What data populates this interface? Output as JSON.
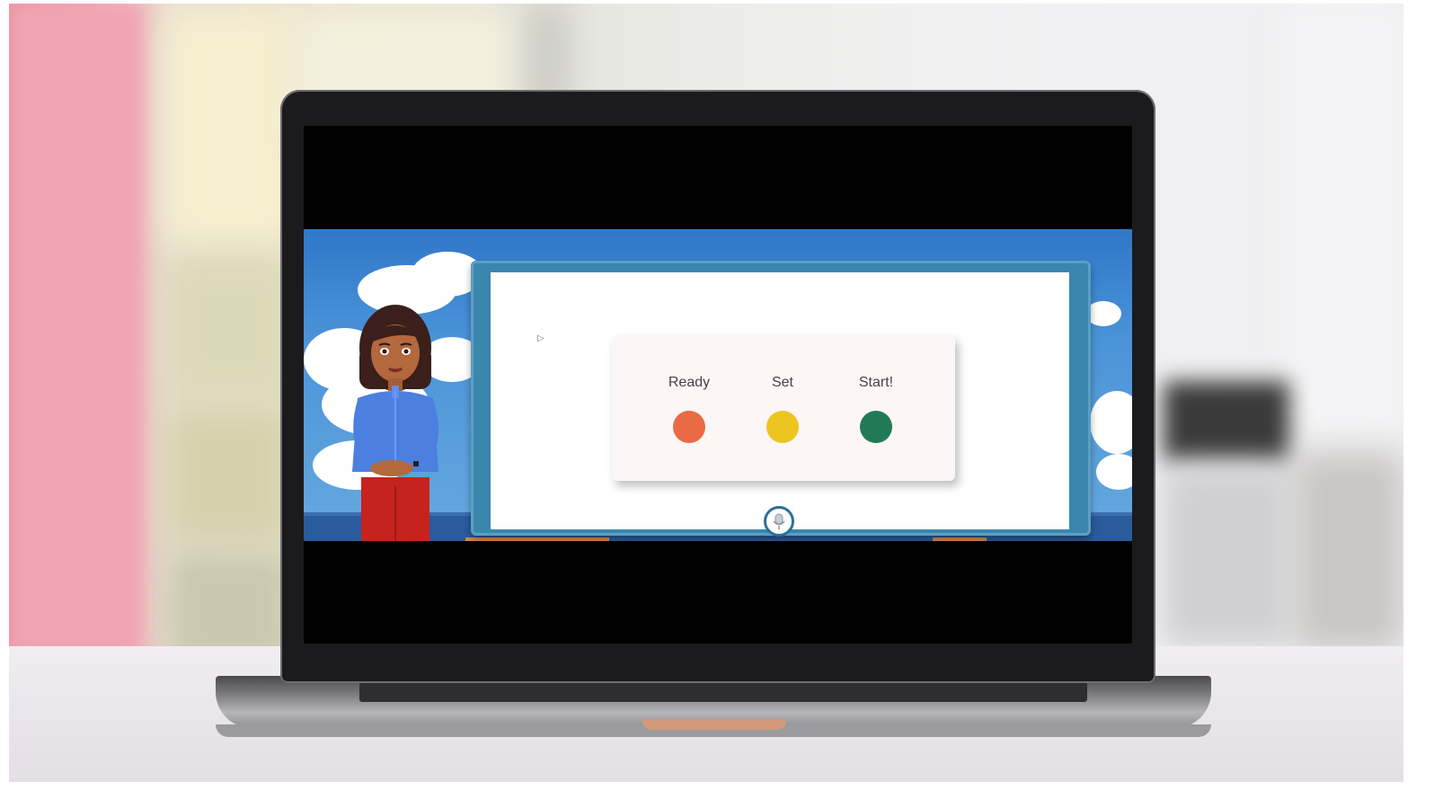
{
  "video_lesson": {
    "steps": [
      {
        "label": "Ready",
        "color": "#ea6a43"
      },
      {
        "label": "Set",
        "color": "#ecc521"
      },
      {
        "label": "Start!",
        "color": "#217a56"
      }
    ],
    "mic_icon": "microphone-icon",
    "colors": {
      "sky": "#4b93d8",
      "board_frame": "#3a86ad",
      "card_background": "#fdf6f6",
      "presenter_shirt": "#4c7fe0",
      "presenter_pants": "#c6231f"
    }
  }
}
